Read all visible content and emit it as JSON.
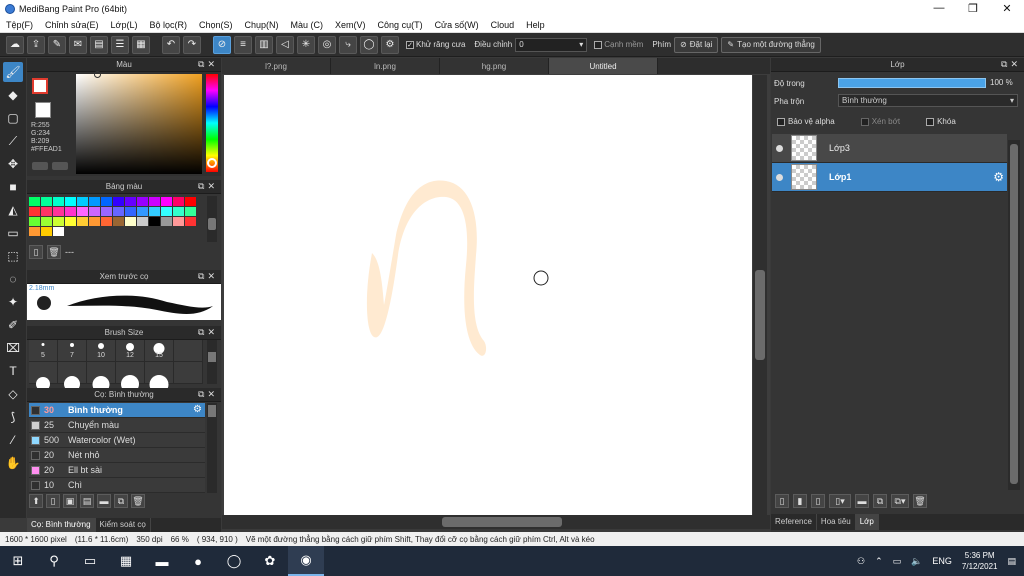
{
  "window": {
    "title": "MediBang Paint Pro (64bit)",
    "controls": [
      "—",
      "❐",
      "✕"
    ]
  },
  "menu": [
    "Tệp(F)",
    "Chỉnh sửa(E)",
    "Lớp(L)",
    "Bộ lọc(R)",
    "Chọn(S)",
    "Chụp(N)",
    "Màu (C)",
    "Xem(V)",
    "Công cụ(T)",
    "Cửa số(W)",
    "Cloud",
    "Help"
  ],
  "toolbar": {
    "antialias_label": "Khử răng cưa",
    "correction_label": "Điều chỉnh",
    "correction_value": "0",
    "snap_edge_label": "Cạnh mềm",
    "key_label": "Phím",
    "reset_label": "Đặt lại",
    "line_label": "Tạo một đường thẳng"
  },
  "color_panel": {
    "title": "Màu",
    "r": "R:255",
    "g": "G:234",
    "b": "B:209",
    "hex": "#FFEAD1",
    "fg_color": "#ffffff",
    "bg_color": "#ffffff"
  },
  "palette_panel": {
    "title": "Bảng màu",
    "name": "---",
    "colors": [
      "#00ff66",
      "#00ff99",
      "#00ffcc",
      "#00ffff",
      "#00ccff",
      "#0099ff",
      "#0066ff",
      "#3300ff",
      "#6600ff",
      "#9900ff",
      "#cc00ff",
      "#ff00ff",
      "#ff0066",
      "#ff0000",
      "#ff3333",
      "#ff3366",
      "#ff3399",
      "#ff33cc",
      "#ff66ff",
      "#cc66ff",
      "#9966ff",
      "#6666ff",
      "#3366ff",
      "#3399ff",
      "#33ccff",
      "#33ffff",
      "#33ffcc",
      "#33ff99",
      "#66ff33",
      "#99ff33",
      "#ccff33",
      "#ffff33",
      "#ffcc33",
      "#ff9933",
      "#ff6633",
      "#996633",
      "#ffffcc",
      "#cccccc",
      "#000000",
      "#999999",
      "#ff9999",
      "#ff3333",
      "#ff9933",
      "#ffcc00",
      "#ffffff"
    ]
  },
  "preview_panel": {
    "title": "Xem trước cọ",
    "size": "2.18mm"
  },
  "brush_size_panel": {
    "title": "Brush Size",
    "sizes": [
      {
        "label": "5",
        "d": 3
      },
      {
        "label": "7",
        "d": 4
      },
      {
        "label": "10",
        "d": 6
      },
      {
        "label": "12",
        "d": 8
      },
      {
        "label": "15",
        "d": 11
      },
      {
        "label": "",
        "d": 0
      },
      {
        "label": "",
        "d": 14
      },
      {
        "label": "",
        "d": 16
      },
      {
        "label": "",
        "d": 17
      },
      {
        "label": "",
        "d": 18
      },
      {
        "label": "",
        "d": 19
      },
      {
        "label": "",
        "d": 0
      }
    ]
  },
  "brush_panel": {
    "title": "Cọ: Bình thường",
    "brushes": [
      {
        "size": "30",
        "name": "Bình thường",
        "color": "#303030",
        "selected": true
      },
      {
        "size": "25",
        "name": "Chuyển màu",
        "color": "#cfcfcf",
        "selected": false
      },
      {
        "size": "500",
        "name": "Watercolor (Wet)",
        "color": "#8fd8ff",
        "selected": false
      },
      {
        "size": "20",
        "name": "Nét nhỏ",
        "color": "#303030",
        "selected": false
      },
      {
        "size": "20",
        "name": "Ell bt sài",
        "color": "#ff8ff0",
        "selected": false
      },
      {
        "size": "10",
        "name": "Chì",
        "color": "#303030",
        "selected": false
      }
    ]
  },
  "left_tabs": [
    "Cọ: Bình thường",
    "Kiểm soát cọ"
  ],
  "doc_tabs": [
    "l?.png",
    "ln.png",
    "hg.png",
    "Untitled"
  ],
  "layer_panel": {
    "title": "Lớp",
    "opacity_label": "Độ trong",
    "opacity_value": "100 %",
    "blend_label": "Pha trộn",
    "blend_value": "Bình thường",
    "protect_alpha": "Bảo vệ alpha",
    "clipping": "Xén bớt",
    "lock": "Khóa",
    "layers": [
      {
        "name": "Lớp3",
        "selected": false
      },
      {
        "name": "Lớp1",
        "selected": true
      }
    ]
  },
  "right_tabs": [
    "Reference",
    "Hoa tiêu",
    "Lớp"
  ],
  "status": {
    "size": "1600 * 1600 pixel",
    "physical": "(11.6 * 11.6cm)",
    "dpi": "350 dpi",
    "zoom": "66 %",
    "coords": "( 934, 910 )",
    "hint": "Vẽ một đường thẳng bằng cách giữ phím Shift, Thay đổi cỡ cọ bằng cách giữ phím Ctrl, Alt và kéo"
  },
  "taskbar": {
    "lang": "ENG",
    "time": "5:36 PM",
    "date": "7/12/2021"
  },
  "stroke_color": "#ffead1"
}
